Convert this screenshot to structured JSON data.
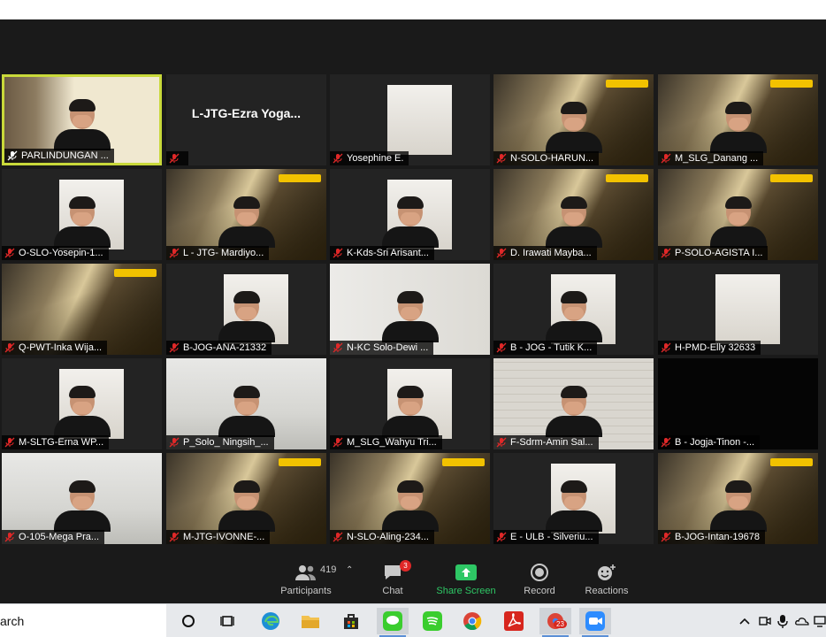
{
  "participants_tiles": [
    {
      "name": "PARLINDUNGAN ...",
      "scene": "books",
      "active": true,
      "person": true
    },
    {
      "name": "",
      "scene": "plain",
      "center": "L-JTG-Ezra  Yoga..."
    },
    {
      "name": "Yosephine E.",
      "scene": "plain",
      "inset": true
    },
    {
      "name": "N-SOLO-HARUN...",
      "scene": "gold",
      "person": true
    },
    {
      "name": "M_SLG_Danang ...",
      "scene": "gold",
      "person": true
    },
    {
      "name": "O-SLO-Yosepin-1...",
      "scene": "plain",
      "inset": true,
      "person": true
    },
    {
      "name": "L - JTG- Mardiyo...",
      "scene": "gold",
      "person": true
    },
    {
      "name": "K-Kds-Sri Arisant...",
      "scene": "plain",
      "inset": true,
      "person": true
    },
    {
      "name": "D. Irawati Mayba...",
      "scene": "gold",
      "person": true
    },
    {
      "name": "P-SOLO-AGISTA I...",
      "scene": "gold",
      "person": true
    },
    {
      "name": "Q-PWT-Inka Wija...",
      "scene": "gold",
      "person": false
    },
    {
      "name": "B-JOG-ANA-21332",
      "scene": "plain",
      "inset": true,
      "person": true
    },
    {
      "name": "N-KC Solo-Dewi ...",
      "scene": "wall",
      "person": true
    },
    {
      "name": "B - JOG - Tutik K...",
      "scene": "plain",
      "inset": true,
      "person": true
    },
    {
      "name": "H-PMD-Elly 32633",
      "scene": "plain",
      "inset": true,
      "person": false
    },
    {
      "name": "M-SLTG-Erna WP...",
      "scene": "plain",
      "inset": true,
      "person": true
    },
    {
      "name": "P_Solo_ Ningsih_...",
      "scene": "room",
      "person": true
    },
    {
      "name": "M_SLG_Wahyu Tri...",
      "scene": "plain",
      "inset": true,
      "person": true
    },
    {
      "name": "F-Sdrm-Amin Sal...",
      "scene": "brick",
      "person": true
    },
    {
      "name": "B - Jogja-Tinon -...",
      "scene": "dark",
      "person": false
    },
    {
      "name": "O-105-Mega Pra...",
      "scene": "room",
      "person": true
    },
    {
      "name": "M-JTG-IVONNE-...",
      "scene": "gold",
      "person": true
    },
    {
      "name": "N-SLO-Aling-234...",
      "scene": "gold",
      "person": true
    },
    {
      "name": "E - ULB - Silveriu...",
      "scene": "plain",
      "inset": true,
      "person": true
    },
    {
      "name": "B-JOG-Intan-19678",
      "scene": "gold",
      "person": true
    }
  ],
  "toolbar": {
    "participants_label": "Participants",
    "participants_count": "419",
    "chat_label": "Chat",
    "chat_badge": "3",
    "share_label": "Share Screen",
    "record_label": "Record",
    "reactions_label": "Reactions"
  },
  "taskbar": {
    "search_text": "arch",
    "chrome_badge": "23",
    "icons": [
      "cortana-icon",
      "task-view-icon",
      "edge-icon",
      "file-explorer-icon",
      "store-icon",
      "line-icon",
      "spotify-icon",
      "chrome-icon",
      "acrobat-icon",
      "chrome-profile-icon",
      "zoom-icon"
    ]
  },
  "colors": {
    "active_border": "#c9d93a",
    "share_green": "#2ec765",
    "mic_muted_red": "#e02828",
    "zoom_bg": "#1a1a1a"
  }
}
